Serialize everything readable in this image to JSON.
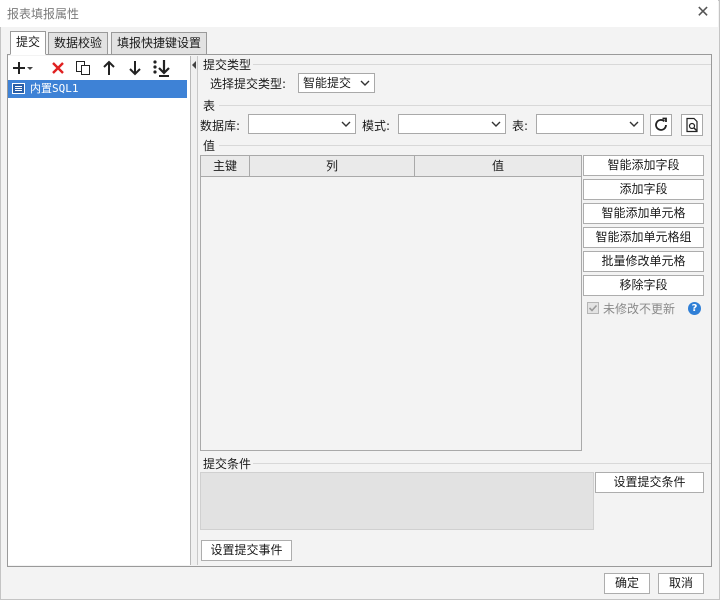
{
  "window": {
    "title": "报表填报属性",
    "close_symbol": "✕"
  },
  "tabs": [
    {
      "label": "提交",
      "active": true
    },
    {
      "label": "数据校验",
      "active": false
    },
    {
      "label": "填报快捷键设置",
      "active": false
    }
  ],
  "toolbar": {
    "icons": [
      "add-dropdown-icon",
      "delete-icon",
      "copy-icon",
      "move-up-icon",
      "move-down-icon",
      "move-to-bottom-icon"
    ],
    "delete_color": "#e02020"
  },
  "tree": {
    "items": [
      {
        "label": "内置SQL1",
        "selected": true
      }
    ]
  },
  "submit_type": {
    "section_title": "提交类型",
    "select_label": "选择提交类型:",
    "selected_value": "智能提交"
  },
  "table_section": {
    "section_title": "表",
    "database_label": "数据库:",
    "database_value": "",
    "schema_label": "模式:",
    "schema_value": "",
    "table_label": "表:",
    "table_value": "",
    "icons": [
      "refresh-icon",
      "preview-icon"
    ]
  },
  "value_section": {
    "section_title": "值",
    "columns": [
      "主键",
      "列",
      "值"
    ],
    "rows": [],
    "buttons": [
      "智能添加字段",
      "添加字段",
      "智能添加单元格",
      "智能添加单元格组",
      "批量修改单元格",
      "移除字段"
    ],
    "checkbox_label": "未修改不更新",
    "checkbox_checked": true,
    "help_symbol": "?"
  },
  "condition_section": {
    "section_title": "提交条件",
    "set_button": "设置提交条件"
  },
  "event_button": "设置提交事件",
  "footer": {
    "ok": "确定",
    "cancel": "取消"
  },
  "colors": {
    "accent_selection": "#3e82d6",
    "help_blue": "#2f7fd6"
  }
}
